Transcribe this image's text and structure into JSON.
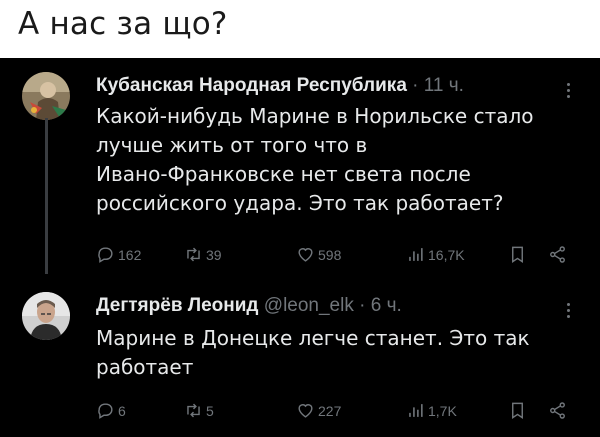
{
  "header": {
    "caption": "А нас за що?"
  },
  "tweets": [
    {
      "author": "Кубанская Народная Республика",
      "meta": " · 11 ч.",
      "text": "Какой-нибудь Марине в Норильске стало\nлучше жить от того что в\nИвано-Франковске нет света после\nроссийского удара. Это так работает?",
      "replies": "162",
      "retweets": "39",
      "likes": "598",
      "views": "16,7K"
    },
    {
      "author": "Дегтярёв Леонид",
      "meta": " @leon_elk · 6 ч.",
      "text": "Марине в Донецке легче станет. Это так\nработает",
      "replies": "6",
      "retweets": "5",
      "likes": "227",
      "views": "1,7K"
    }
  ],
  "icons": {
    "reply": "reply-icon",
    "retweet": "retweet-icon",
    "like": "heart-icon",
    "views": "views-icon",
    "bookmark": "bookmark-icon",
    "share": "share-icon",
    "more": "more-icon"
  },
  "colors": {
    "text": "#e7e9ea",
    "muted": "#71767b",
    "background": "#000000"
  }
}
